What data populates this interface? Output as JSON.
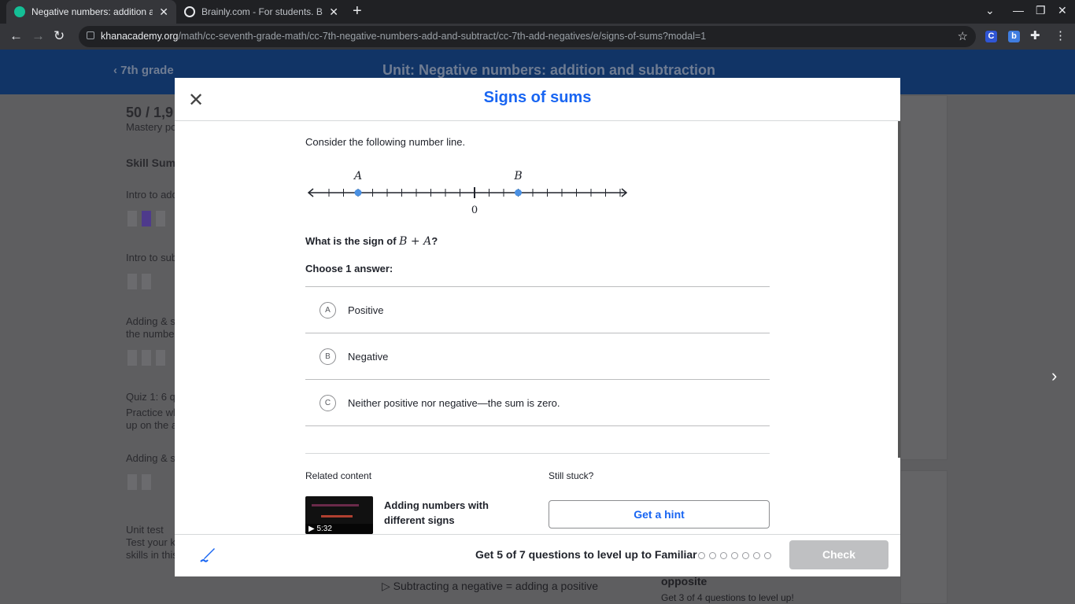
{
  "browser": {
    "tabs": [
      {
        "title": "Negative numbers: addition and",
        "active": true,
        "favicon_color": "#14bf96"
      },
      {
        "title": "Brainly.com - For students. By st",
        "active": false,
        "favicon_color": "#e8eaed"
      }
    ],
    "url_domain": "khanacademy.org",
    "url_path": "/math/cc-seventh-grade-math/cc-7th-negative-numbers-add-and-subtract/cc-7th-add-negatives/e/signs-of-sums?modal=1",
    "extensions": [
      {
        "label": "C",
        "color": "#2f55d4"
      },
      {
        "label": "b",
        "color": "#3f7de0"
      }
    ]
  },
  "page": {
    "back_link": "7th grade",
    "unit_title": "Unit: Negative numbers: addition and subtraction",
    "points": "50 / 1,9",
    "mastery": "Mastery po",
    "skill_summary": "Skill Summ",
    "items": [
      "Intro to add",
      "Intro to sub",
      "Adding & s",
      "the number",
      "Quiz 1: 6 q",
      "Practice wh",
      "up on the a",
      "Adding & s",
      "Unit test",
      "Test your k",
      "skills in this"
    ],
    "bottom_link": "Subtracting a negative = adding a positive",
    "bottom_card_title": "opposite",
    "bottom_card_sub": "Get 3 of 4 questions to level up!"
  },
  "modal": {
    "title": "Signs of sums",
    "intro": "Consider the following number line.",
    "numberline": {
      "min": -10,
      "max": 10,
      "points": [
        {
          "label": "A",
          "value": -8
        },
        {
          "label": "B",
          "value": 3
        }
      ],
      "zero_label": "0",
      "point_color": "#4a90e2"
    },
    "prompt_prefix": "What is the sign of ",
    "prompt_math": "B + A",
    "prompt_suffix": "?",
    "choose_label": "Choose 1 answer:",
    "choices": [
      {
        "letter": "A",
        "text": "Positive"
      },
      {
        "letter": "B",
        "text": "Negative"
      },
      {
        "letter": "C",
        "text": "Neither positive nor negative—the sum is zero."
      }
    ],
    "related_label": "Related content",
    "stuck_label": "Still stuck?",
    "video": {
      "title": "Adding numbers with different signs",
      "duration": "▶ 5:32"
    },
    "hint_button": "Get a hint",
    "levelup_text": "Get 5 of 7 questions to level up to Familiar",
    "progress": {
      "completed": 0,
      "total": 7
    },
    "check_button": "Check"
  }
}
